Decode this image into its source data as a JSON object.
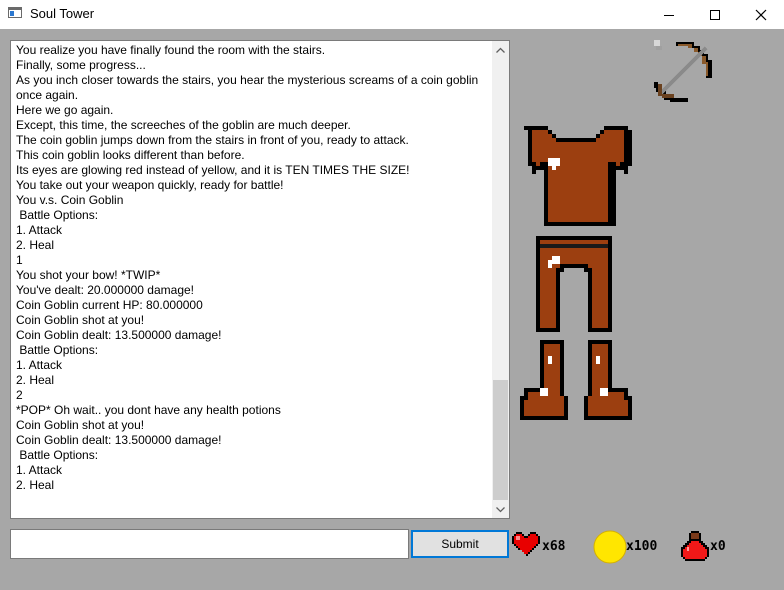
{
  "window": {
    "title": "Soul Tower",
    "minimize_icon": "minimize-icon",
    "maximize_icon": "maximize-icon",
    "close_icon": "close-icon"
  },
  "log": {
    "lines": [
      "You realize you have finally found the room with the stairs.",
      "Finally, some progress...",
      "As you inch closer towards the stairs, you hear the mysterious screams of a coin goblin",
      "once again.",
      "Here we go again.",
      "Except, this time, the screeches of the goblin are much deeper.",
      "The coin goblin jumps down from the stairs in front of you, ready to attack.",
      "This coin goblin looks different than before.",
      "Its eyes are glowing red instead of yellow, and it is TEN TIMES THE SIZE!",
      "You take out your weapon quickly, ready for battle!",
      "You v.s. Coin Goblin",
      " Battle Options:",
      "1. Attack",
      "2. Heal",
      "1",
      "You shot your bow! *TWIP*",
      "You've dealt: 20.000000 damage!",
      "Coin Goblin current HP: 80.000000",
      "Coin Goblin shot at you!",
      "Coin Goblin dealt: 13.500000 damage!",
      " Battle Options:",
      "1. Attack",
      "2. Heal",
      "2",
      "*POP* Oh wait.. you dont have any health potions",
      "Coin Goblin shot at you!",
      "Coin Goblin dealt: 13.500000 damage!",
      " Battle Options:",
      "1. Attack",
      "2. Heal"
    ]
  },
  "input": {
    "value": "",
    "placeholder": ""
  },
  "submit_label": "Submit",
  "stats": {
    "health": "x68",
    "coins": "x100",
    "potions": "x0"
  },
  "equipment": {
    "weapon": "bow-icon",
    "chest": "chestplate-icon",
    "legs": "leggings-icon",
    "feet": "boots-icon"
  },
  "colors": {
    "armor_brown": "#9c3f10",
    "heart_red": "#ff0000",
    "coin_gold": "#ffe400",
    "potion_red": "#ff1a1a",
    "focus_blue": "#0078d7",
    "background": "#a7a7a7"
  }
}
